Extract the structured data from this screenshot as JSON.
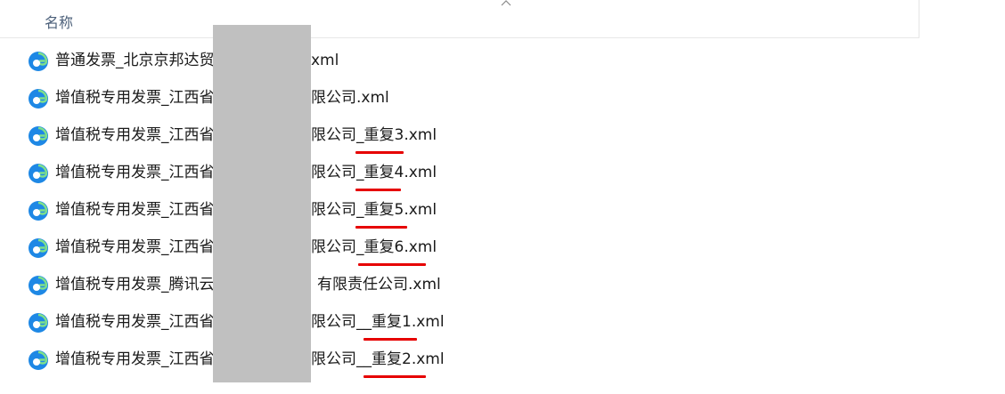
{
  "header": {
    "column_name": "名称"
  },
  "files": [
    {
      "name": "普通发票_北京京邦达贸",
      "visible_suffix": "xml",
      "icon": "edge-xml-icon"
    },
    {
      "name": "增值税专用发票_江西省",
      "visible_suffix": "限公司.xml",
      "icon": "edge-xml-icon"
    },
    {
      "name": "增值税专用发票_江西省",
      "visible_suffix": "限公司_重复3.xml",
      "icon": "edge-xml-icon"
    },
    {
      "name": "增值税专用发票_江西省",
      "visible_suffix": "限公司_重复4.xml",
      "icon": "edge-xml-icon"
    },
    {
      "name": "增值税专用发票_江西省",
      "visible_suffix": "限公司_重复5.xml",
      "icon": "edge-xml-icon"
    },
    {
      "name": "增值税专用发票_江西省",
      "visible_suffix": "限公司_重复6.xml",
      "icon": "edge-xml-icon"
    },
    {
      "name": "增值税专用发票_腾讯云",
      "visible_suffix": "有限责任公司.xml",
      "icon": "edge-xml-icon"
    },
    {
      "name": "增值税专用发票_江西省",
      "visible_suffix": "限公司__重复1.xml",
      "icon": "edge-xml-icon"
    },
    {
      "name": "增值税专用发票_江西省",
      "visible_suffix": "限公司__重复2.xml",
      "icon": "edge-xml-icon"
    }
  ],
  "colors": {
    "header_text": "#4c607a",
    "underline": "#e60000",
    "redaction": "#c0c0c0"
  }
}
